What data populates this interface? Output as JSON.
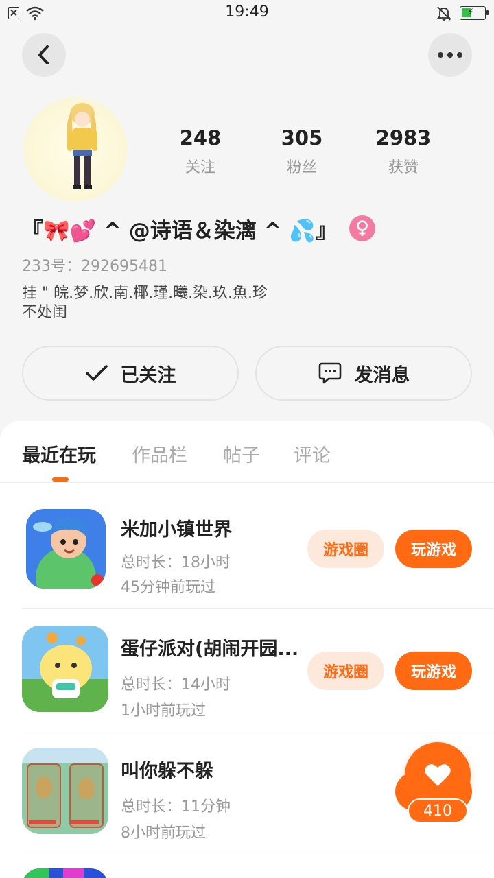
{
  "status_bar": {
    "time": "19:49"
  },
  "profile": {
    "stats": [
      {
        "value": "248",
        "label": "关注"
      },
      {
        "value": "305",
        "label": "粉丝"
      },
      {
        "value": "2983",
        "label": "获赞"
      }
    ],
    "nickname": "『🎀💕 ^ @诗语＆染漓 ^ 💦』",
    "uid": "233号：292695481",
    "bio_line1": "挂 \" 皖.梦.欣.南.椰.瑾.曦.染.玖.魚.珍",
    "bio_line2": "不处闺",
    "follow_label": "已关注",
    "message_label": "发消息"
  },
  "tabs": [
    "最近在玩",
    "作品栏",
    "帖子",
    "评论"
  ],
  "games": [
    {
      "title": "米加小镇世界",
      "duration": "总时长：18小时",
      "last_played": "45分钟前玩过",
      "circle_label": "游戏圈",
      "play_label": "玩游戏"
    },
    {
      "title": "蛋仔派对(胡闹开园...",
      "duration": "总时长：14小时",
      "last_played": "1小时前玩过",
      "circle_label": "游戏圈",
      "play_label": "玩游戏"
    },
    {
      "title": "叫你躲不躲",
      "duration": "总时长：11分钟",
      "last_played": "8小时前玩过"
    }
  ],
  "like_fab": {
    "count": "410",
    "icon": "heart-icon"
  },
  "colors": {
    "accent": "#ff6a13",
    "accent_light": "#fde9dc",
    "gender_badge": "#f57aa2"
  }
}
